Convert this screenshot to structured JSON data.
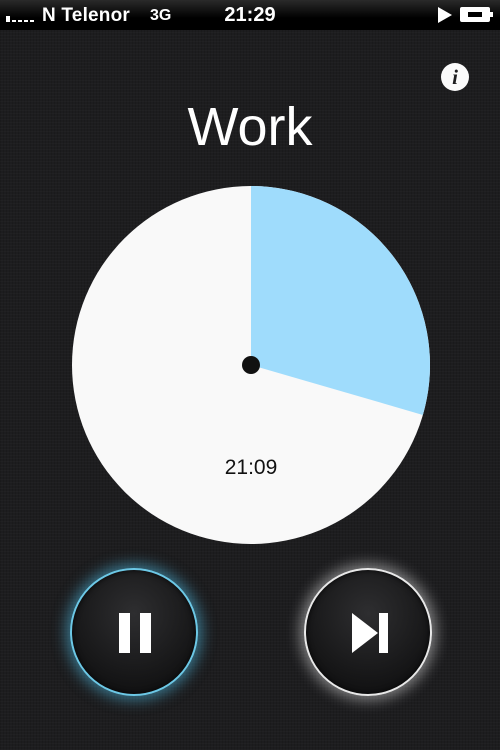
{
  "status_bar": {
    "carrier": "N Telenor",
    "network": "3G",
    "time": "21:29",
    "signal_bars": 1,
    "signal_bars_total": 5,
    "playing_indicator": "play-icon",
    "battery_state": "charging"
  },
  "header": {
    "info_icon": "info-icon",
    "info_glyph": "i",
    "title": "Work"
  },
  "timer": {
    "remaining": "21:09",
    "elapsed_fraction": 0.295,
    "colors": {
      "remaining_face": "#f9f9f9",
      "elapsed_sector": "#9fdcfc",
      "center_dot": "#111111"
    }
  },
  "controls": {
    "pause": {
      "icon": "pause-icon",
      "glow_color": "#6cc8e6",
      "active": true
    },
    "skip": {
      "icon": "skip-forward-icon",
      "glow_color": "#e8e8e8",
      "active": false
    }
  }
}
